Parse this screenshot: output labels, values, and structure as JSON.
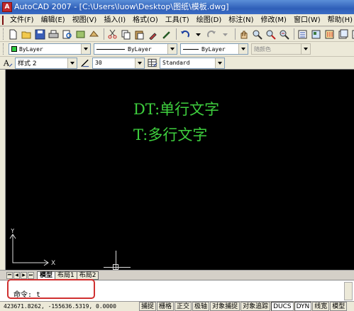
{
  "window": {
    "title": "AutoCAD 2007 - [C:\\Users\\luow\\Desktop\\图纸\\模板.dwg]",
    "app_icon_letter": "A"
  },
  "menu": [
    "文件(F)",
    "编辑(E)",
    "视图(V)",
    "插入(I)",
    "格式(O)",
    "工具(T)",
    "绘图(D)",
    "标注(N)",
    "修改(M)",
    "窗口(W)",
    "帮助(H)"
  ],
  "layer_toolbar": {
    "color": "ByLayer",
    "linetype": "ByLayer",
    "lineweight": "ByLayer",
    "plotstyle": "随颜色",
    "color_swatch": "#2ecc40"
  },
  "style_toolbar": {
    "text_style": "样式 2",
    "dim_style": "30",
    "table_style": "Standard"
  },
  "drawing": {
    "line1": "DT:单行文字",
    "line2": "T:多行文字",
    "text_color": "#3ecf3e",
    "ucs_x_label": "X",
    "ucs_y_label": "Y"
  },
  "tabs": {
    "nav": [
      "⏮",
      "◀",
      "▶",
      "⏭"
    ],
    "items": [
      "模型",
      "布局1",
      "布局2"
    ],
    "active": 0
  },
  "command": {
    "prompt": "命令: t"
  },
  "status": {
    "coords": "423671.8262, -155636.5319, 0.0000",
    "buttons": [
      "捕捉",
      "栅格",
      "正交",
      "极轴",
      "对象捕捉",
      "对象追踪",
      "DUCS",
      "DYN",
      "线宽",
      "模型"
    ]
  }
}
